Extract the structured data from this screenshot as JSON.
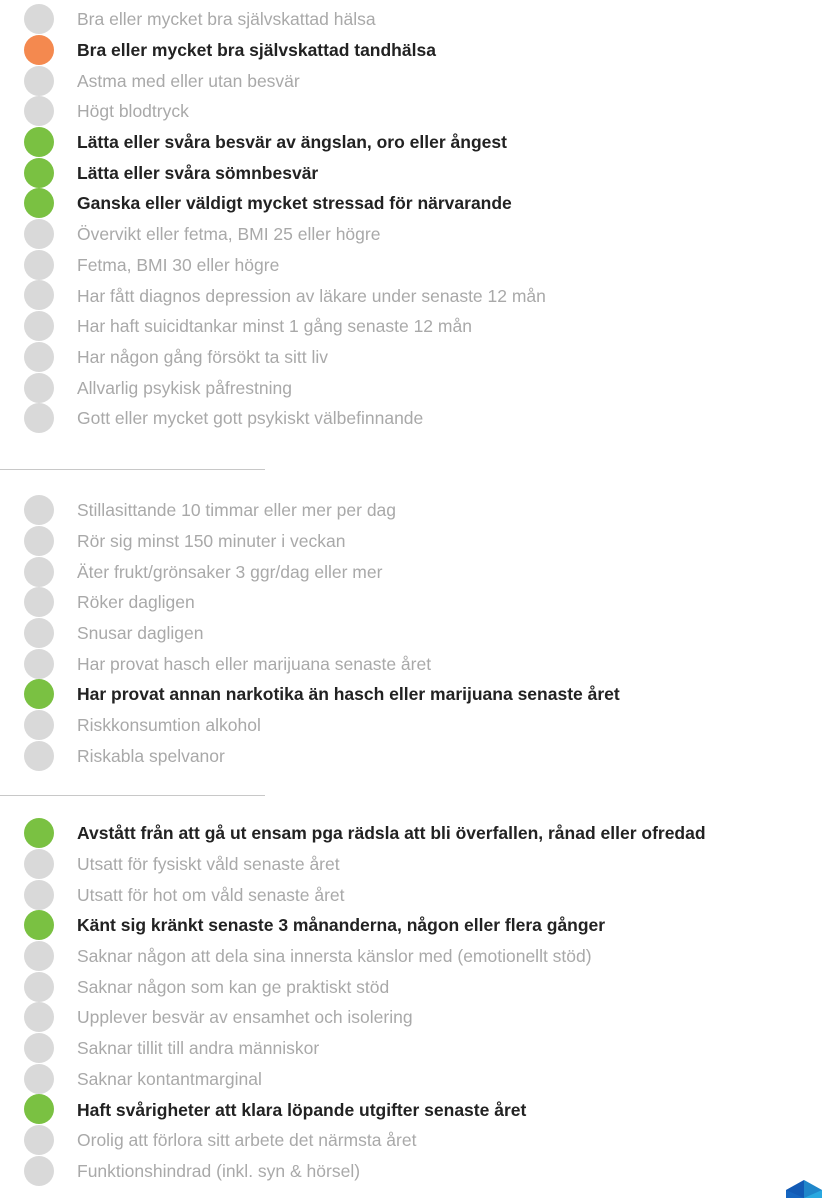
{
  "colors": {
    "gray": "#d9d9d9",
    "orange": "#f4894f",
    "green": "#7ac142",
    "text_muted": "#a9a9a9",
    "text_strong": "#222222"
  },
  "groups": [
    {
      "items": [
        {
          "label": "Bra eller mycket bra självskattad hälsa",
          "status": "gray"
        },
        {
          "label": "Bra eller mycket bra självskattad tandhälsa",
          "status": "orange"
        },
        {
          "label": "Astma med eller utan besvär",
          "status": "gray"
        },
        {
          "label": "Högt blodtryck",
          "status": "gray"
        },
        {
          "label": "Lätta eller svåra besvär av ängslan, oro eller ångest",
          "status": "green"
        },
        {
          "label": "Lätta eller svåra sömnbesvär",
          "status": "green"
        },
        {
          "label": "Ganska eller väldigt mycket stressad för närvarande",
          "status": "green"
        },
        {
          "label": "Övervikt eller fetma, BMI 25 eller högre",
          "status": "gray"
        },
        {
          "label": "Fetma, BMI 30 eller högre",
          "status": "gray"
        },
        {
          "label": "Har fått diagnos depression av läkare under senaste 12 mån",
          "status": "gray"
        },
        {
          "label": "Har haft suicidtankar minst 1 gång senaste 12 mån",
          "status": "gray"
        },
        {
          "label": "Har någon gång försökt ta sitt liv",
          "status": "gray"
        },
        {
          "label": "Allvarlig psykisk påfrestning",
          "status": "gray"
        },
        {
          "label": "Gott eller mycket gott psykiskt välbefinnande",
          "status": "gray"
        }
      ]
    },
    {
      "items": [
        {
          "label": "Stillasittande 10 timmar eller mer per dag",
          "status": "gray"
        },
        {
          "label": "Rör sig minst 150 minuter i veckan",
          "status": "gray"
        },
        {
          "label": "Äter frukt/grönsaker 3 ggr/dag eller mer",
          "status": "gray"
        },
        {
          "label": "Röker dagligen",
          "status": "gray"
        },
        {
          "label": "Snusar dagligen",
          "status": "gray"
        },
        {
          "label": "Har provat hasch eller marijuana senaste året",
          "status": "gray"
        },
        {
          "label": "Har provat annan narkotika än hasch eller marijuana senaste året",
          "status": "green"
        },
        {
          "label": "Riskkonsumtion alkohol",
          "status": "gray"
        },
        {
          "label": "Riskabla spelvanor",
          "status": "gray"
        }
      ]
    },
    {
      "items": [
        {
          "label": "Avstått från att gå ut ensam pga rädsla att bli överfallen, rånad eller ofredad",
          "status": "green"
        },
        {
          "label": "Utsatt för fysiskt våld senaste året",
          "status": "gray"
        },
        {
          "label": "Utsatt för hot om våld senaste året",
          "status": "gray"
        },
        {
          "label": "Känt sig kränkt senaste 3 månanderna, någon eller flera gånger",
          "status": "green"
        },
        {
          "label": "Saknar någon att dela sina innersta känslor med (emotionellt stöd)",
          "status": "gray"
        },
        {
          "label": "Saknar någon som kan ge praktiskt stöd",
          "status": "gray"
        },
        {
          "label": "Upplever besvär av ensamhet och isolering",
          "status": "gray"
        },
        {
          "label": "Saknar tillit till andra människor",
          "status": "gray"
        },
        {
          "label": "Saknar kontantmarginal",
          "status": "gray"
        },
        {
          "label": "Haft svårigheter att klara löpande utgifter senaste året",
          "status": "green"
        },
        {
          "label": "Orolig att förlora sitt arbete det närmsta året",
          "status": "gray"
        },
        {
          "label": "Funktionshindrad (inkl. syn & hörsel)",
          "status": "gray"
        }
      ]
    }
  ],
  "logo_icon": "cube-logo-icon"
}
